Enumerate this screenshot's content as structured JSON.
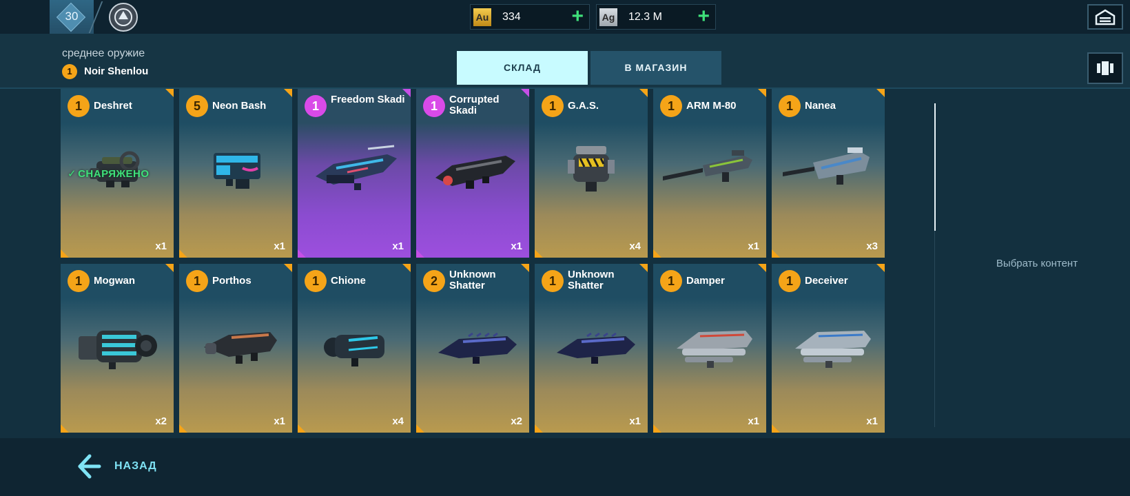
{
  "topbar": {
    "level": "30",
    "currencies": [
      {
        "code": "Au",
        "value": "334"
      },
      {
        "code": "Ag",
        "value": "12.3 M"
      }
    ]
  },
  "header": {
    "category": "среднее оружие",
    "pilot_badge": "1",
    "pilot_name": "Noir Shenlou",
    "tabs": [
      {
        "label": "СКЛАД",
        "active": true
      },
      {
        "label": "В МАГАЗИН",
        "active": false
      }
    ]
  },
  "cards": [
    {
      "tier": "1",
      "name": "Deshret",
      "qty": "x1",
      "rarity": "gold",
      "equipped_label": "СНАРЯЖЕНО",
      "icon": "heavy-cannon-icon"
    },
    {
      "tier": "5",
      "name": "Neon Bash",
      "qty": "x1",
      "rarity": "gold",
      "icon": "neon-blaster-icon"
    },
    {
      "tier": "1",
      "name": "Freedom Skadi",
      "qty": "x1",
      "rarity": "purple",
      "icon": "skadi-cannon-icon"
    },
    {
      "tier": "1",
      "name": "Corrupted Skadi",
      "qty": "x1",
      "rarity": "purple",
      "icon": "skadi-cannon-icon"
    },
    {
      "tier": "1",
      "name": "G.A.S.",
      "qty": "x4",
      "rarity": "gold",
      "icon": "gas-canister-icon"
    },
    {
      "tier": "1",
      "name": "ARM M-80",
      "qty": "x1",
      "rarity": "gold",
      "icon": "sniper-rifle-icon"
    },
    {
      "tier": "1",
      "name": "Nanea",
      "qty": "x3",
      "rarity": "gold",
      "icon": "rifle-icon"
    },
    {
      "tier": "1",
      "name": "Mogwan",
      "qty": "x2",
      "rarity": "gold",
      "icon": "gatling-icon"
    },
    {
      "tier": "1",
      "name": "Porthos",
      "qty": "x1",
      "rarity": "gold",
      "icon": "launcher-icon"
    },
    {
      "tier": "1",
      "name": "Chione",
      "qty": "x4",
      "rarity": "gold",
      "icon": "cryo-gun-icon"
    },
    {
      "tier": "2",
      "name": "Unknown Shatter",
      "qty": "x2",
      "rarity": "gold",
      "icon": "shatter-gun-icon"
    },
    {
      "tier": "1",
      "name": "Unknown Shatter",
      "qty": "x1",
      "rarity": "gold",
      "icon": "shatter-gun-icon"
    },
    {
      "tier": "1",
      "name": "Damper",
      "qty": "x1",
      "rarity": "gold",
      "icon": "rocket-pod-icon"
    },
    {
      "tier": "1",
      "name": "Deceiver",
      "qty": "x1",
      "rarity": "gold",
      "icon": "rocket-pod-icon"
    }
  ],
  "right_panel": {
    "choose_content": "Выбрать контент"
  },
  "footer": {
    "back_label": "НАЗАД"
  },
  "colors": {
    "accent_gold": "#f5a418",
    "accent_purple": "#c64fe6",
    "accent_green": "#3fe07a",
    "tab_active": "#c8fbff"
  }
}
